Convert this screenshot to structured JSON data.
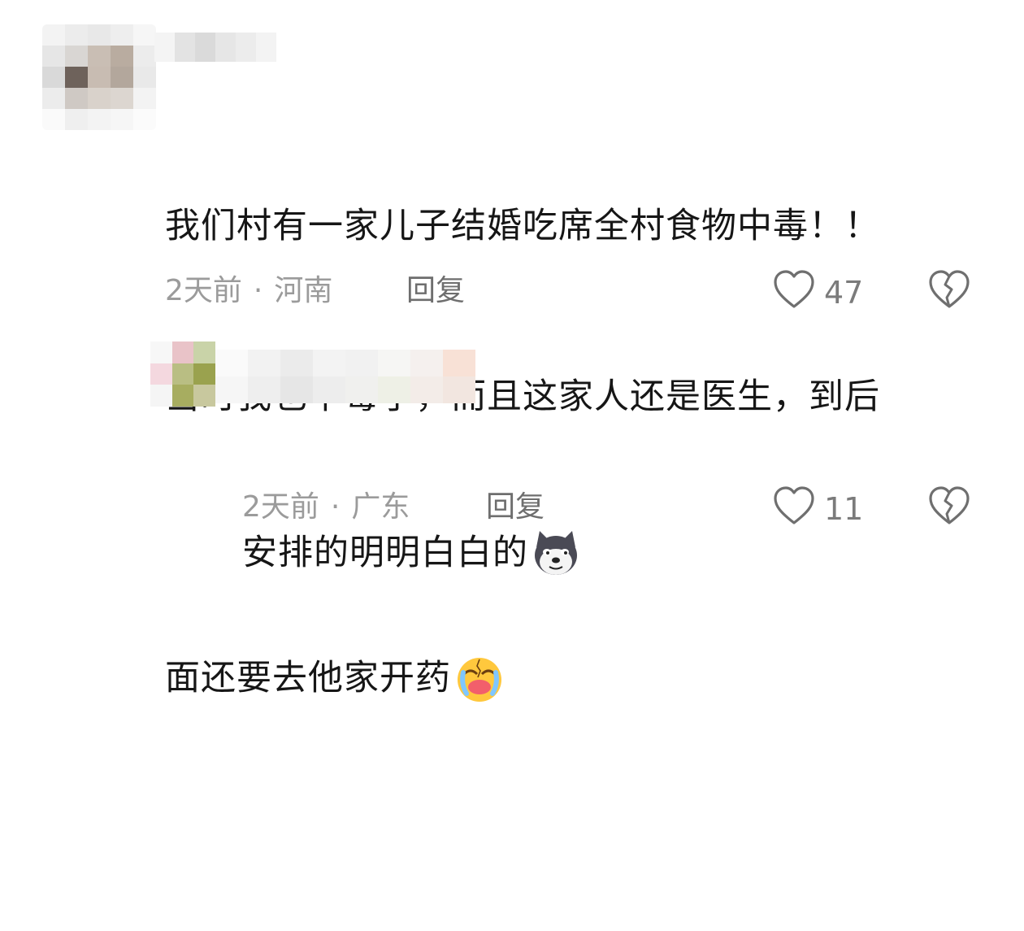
{
  "comments": [
    {
      "text_lines": [
        "我们村有一家儿子结婚吃席全村食物中毒！！",
        "当时我也中毒了，而且这家人还是医生，到后",
        "面还要去他家开药"
      ],
      "emoji": "crying-face-icon",
      "time": "2天前",
      "separator": "·",
      "location": "河南",
      "reply_label": "回复",
      "likes": "47"
    },
    {
      "text": "安排的明明白白的",
      "emoji": "doge-icon",
      "time": "2天前",
      "separator": "·",
      "location": "广东",
      "reply_label": "回复",
      "likes": "11"
    }
  ],
  "colors": {
    "text": "#161616",
    "meta": "#9b9b9b",
    "icon": "#6f6f6f"
  }
}
